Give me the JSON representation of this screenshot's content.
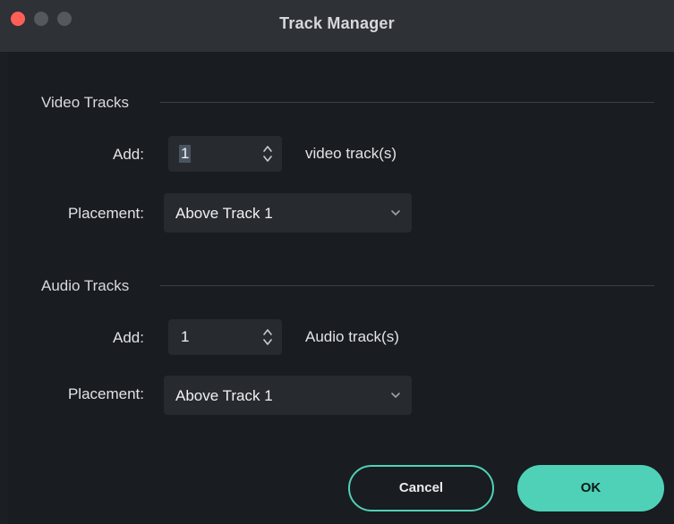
{
  "window": {
    "title": "Track Manager"
  },
  "video": {
    "section_label": "Video Tracks",
    "add_label": "Add:",
    "count": "1",
    "suffix": "video track(s)",
    "placement_label": "Placement:",
    "placement_value": "Above Track 1"
  },
  "audio": {
    "section_label": "Audio Tracks",
    "add_label": "Add:",
    "count": "1",
    "suffix": "Audio track(s)",
    "placement_label": "Placement:",
    "placement_value": "Above Track 1"
  },
  "buttons": {
    "cancel": "Cancel",
    "ok": "OK"
  },
  "colors": {
    "accent": "#4fd1b8",
    "close": "#ff5f57",
    "background": "#191c20",
    "field": "#272b30"
  },
  "icons": {
    "stepper": "up-down-chevron-icon",
    "dropdown": "chevron-down-icon"
  }
}
